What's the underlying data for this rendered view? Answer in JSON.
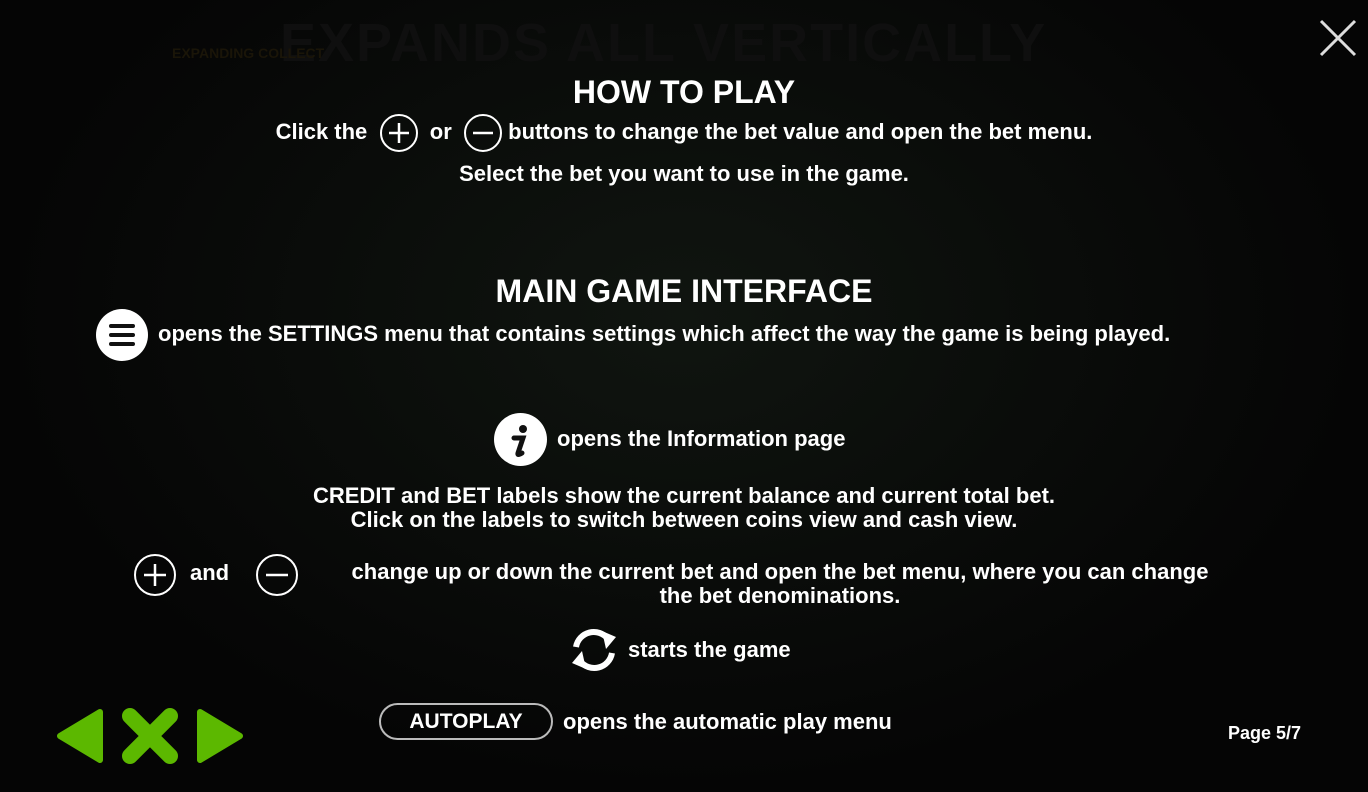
{
  "background": {
    "title": "EXPANDS ALL VERTICALLY",
    "badge": "EXPANDING COLLECT"
  },
  "how_to_play": {
    "title": "HOW TO PLAY",
    "line1_a": "Click the",
    "line1_b": "or",
    "line1_c": "buttons to change the bet value and open the bet menu.",
    "line2": "Select the bet you want to use in the game."
  },
  "main_interface": {
    "title": "MAIN GAME INTERFACE",
    "settings_text": "opens the SETTINGS menu that contains settings which affect the way the game is being played.",
    "info_text": "opens the Information page",
    "credit_line1": "CREDIT and BET labels show the current balance and current total bet.",
    "credit_line2": "Click on the labels to switch between coins view and cash view.",
    "bet_and": "and",
    "bet_line1": "change up or down the current bet and open the bet menu, where you can change",
    "bet_line2": "the bet denominations.",
    "spin_text": "starts the game",
    "autoplay_label": "AUTOPLAY",
    "autoplay_text": "opens the automatic play menu"
  },
  "footer": {
    "page": "Page 5/7"
  },
  "colors": {
    "nav_green": "#5cb800",
    "text": "#ffffff"
  }
}
